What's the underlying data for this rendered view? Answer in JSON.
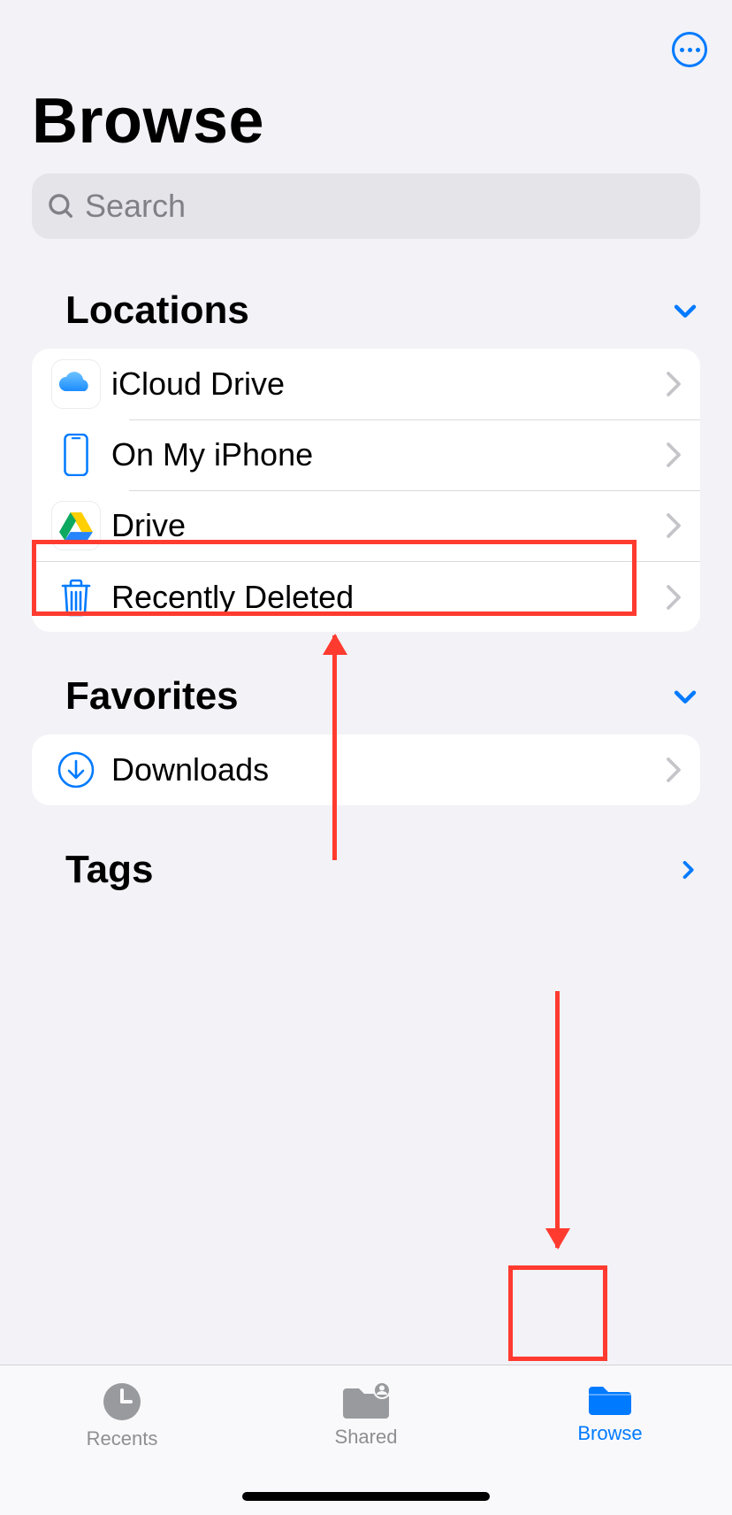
{
  "header": {
    "title": "Browse"
  },
  "search": {
    "placeholder": "Search"
  },
  "sections": {
    "locations": {
      "title": "Locations",
      "items": [
        {
          "label": "iCloud Drive",
          "icon": "icloud-drive-icon"
        },
        {
          "label": "On My iPhone",
          "icon": "iphone-icon"
        },
        {
          "label": "Drive",
          "icon": "google-drive-icon"
        },
        {
          "label": "Recently Deleted",
          "icon": "trash-icon"
        }
      ]
    },
    "favorites": {
      "title": "Favorites",
      "items": [
        {
          "label": "Downloads",
          "icon": "download-circle-icon"
        }
      ]
    },
    "tags": {
      "title": "Tags"
    }
  },
  "tabs": [
    {
      "label": "Recents",
      "icon": "clock-icon",
      "active": false
    },
    {
      "label": "Shared",
      "icon": "shared-folder-icon",
      "active": false
    },
    {
      "label": "Browse",
      "icon": "folder-icon",
      "active": true
    }
  ],
  "colors": {
    "accent": "#007aff",
    "annotation": "#ff3b30",
    "background": "#f2f2f7",
    "secondaryText": "#8e8e93"
  }
}
